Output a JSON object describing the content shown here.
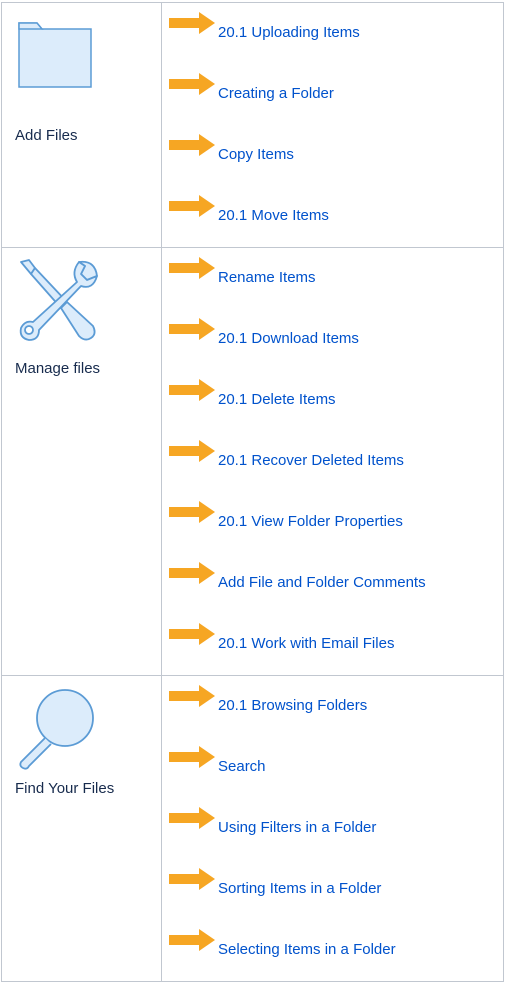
{
  "colors": {
    "link": "#0052cc",
    "arrow": "#f6a623",
    "icon_stroke": "#5b9bd5",
    "icon_fill": "#dcecfb",
    "border": "#c1c7d0"
  },
  "sections": [
    {
      "label": "Add Files",
      "icon": "folder-icon",
      "links": [
        "20.1 Uploading Items",
        "Creating a Folder",
        "Copy Items",
        "20.1 Move Items"
      ]
    },
    {
      "label": "Manage files",
      "icon": "tools-icon",
      "links": [
        "Rename Items",
        "20.1 Download Items",
        "20.1 Delete Items",
        "20.1 Recover Deleted Items",
        "20.1 View Folder Properties",
        "Add File and Folder Comments",
        "20.1 Work with Email Files"
      ]
    },
    {
      "label": "Find Your Files",
      "icon": "magnifier-icon",
      "links": [
        "20.1 Browsing Folders",
        "Search",
        "Using Filters in a Folder",
        "Sorting Items in a Folder",
        "Selecting Items in a Folder"
      ]
    }
  ]
}
